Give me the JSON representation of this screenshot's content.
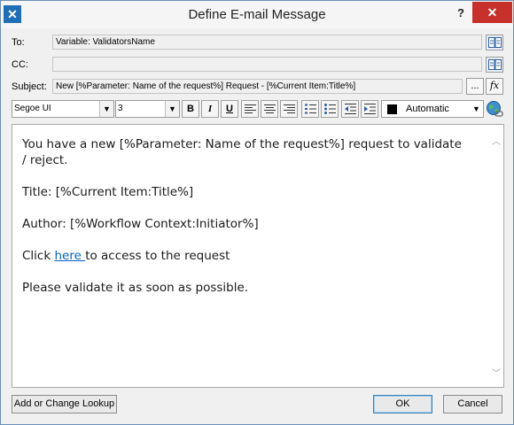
{
  "window": {
    "title": "Define E-mail Message",
    "help_label": "?",
    "close_label": "✕"
  },
  "fields": {
    "to_label": "To:",
    "to_value": "Variable: ValidatorsName",
    "cc_label": "CC:",
    "cc_value": "",
    "subject_label": "Subject:",
    "subject_value": "New [%Parameter: Name of the request%] Request - [%Current Item:Title%]",
    "ellipsis_label": "...",
    "fx_label": "fx"
  },
  "toolbar": {
    "font_name": "Segoe UI",
    "font_size": "3",
    "bold_label": "B",
    "italic_label": "I",
    "underline_label": "U",
    "color_label": "Automatic",
    "color_hex": "#000000"
  },
  "body": {
    "line1": "You have a new [%Parameter: Name of the request%] request to validate / reject.",
    "line2": "Title: [%Current Item:Title%]",
    "line3": "Author: [%Workflow Context:Initiator%]",
    "line4_prefix": "Click ",
    "line4_link": "here ",
    "line4_suffix": "to access to the request",
    "line5": "Please validate it as soon as possible."
  },
  "footer": {
    "lookup_button": "Add or Change Lookup",
    "ok_button": "OK",
    "cancel_button": "Cancel"
  },
  "colors": {
    "accent": "#1f6fb5",
    "close": "#c7312b",
    "link": "#0563c1"
  }
}
